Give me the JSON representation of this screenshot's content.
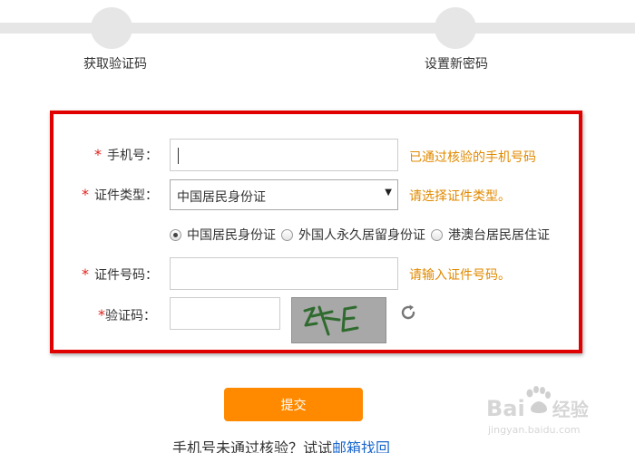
{
  "steps": [
    {
      "label": "获取验证码"
    },
    {
      "label": "设置新密码"
    }
  ],
  "form": {
    "required_mark": "*",
    "phone": {
      "label": "手机号：",
      "value": "",
      "hint": "已通过核验的手机号码"
    },
    "id_type": {
      "label": "证件类型：",
      "selected": "中国居民身份证",
      "hint": "请选择证件类型。",
      "options": [
        {
          "label": "中国居民身份证",
          "checked": true
        },
        {
          "label": "外国人永久居留身份证",
          "checked": false
        },
        {
          "label": "港澳台居民居住证",
          "checked": false
        }
      ]
    },
    "id_number": {
      "label": "证件号码：",
      "value": "",
      "hint": "请输入证件号码。"
    },
    "captcha": {
      "label": "验证码：",
      "value": "",
      "image_text": "zE"
    },
    "submit_label": "提交"
  },
  "footer": {
    "prefix": "手机号未通过核验？试试",
    "link": "邮箱找回"
  },
  "watermark": {
    "brand": "Bai",
    "brand_tail": "经验",
    "url": "jingyan.baidu.com"
  },
  "colors": {
    "accent": "#ff8a00",
    "hint": "#e08a00",
    "required": "#e0201b",
    "frame": "#e00000",
    "link": "#1a66cc"
  }
}
